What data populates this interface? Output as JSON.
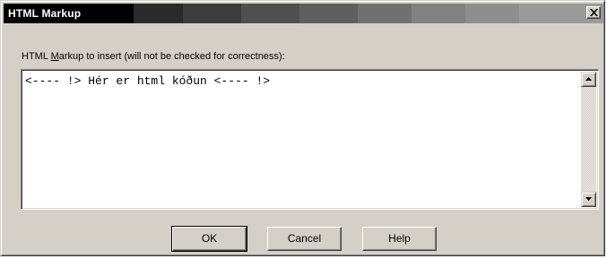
{
  "window": {
    "title": "HTML Markup",
    "close_glyph": "close-icon"
  },
  "markup_label": {
    "prefix": "HTML ",
    "accel": "M",
    "rest": "arkup to insert (will not be checked for correctness):"
  },
  "markup_input": {
    "value": "<---- !> Hér er html kóðun <---- !>"
  },
  "scrollbar": {
    "up_icon": "arrow-up-icon",
    "down_icon": "arrow-down-icon"
  },
  "buttons": {
    "ok": "OK",
    "cancel": "Cancel",
    "help": "Help"
  }
}
